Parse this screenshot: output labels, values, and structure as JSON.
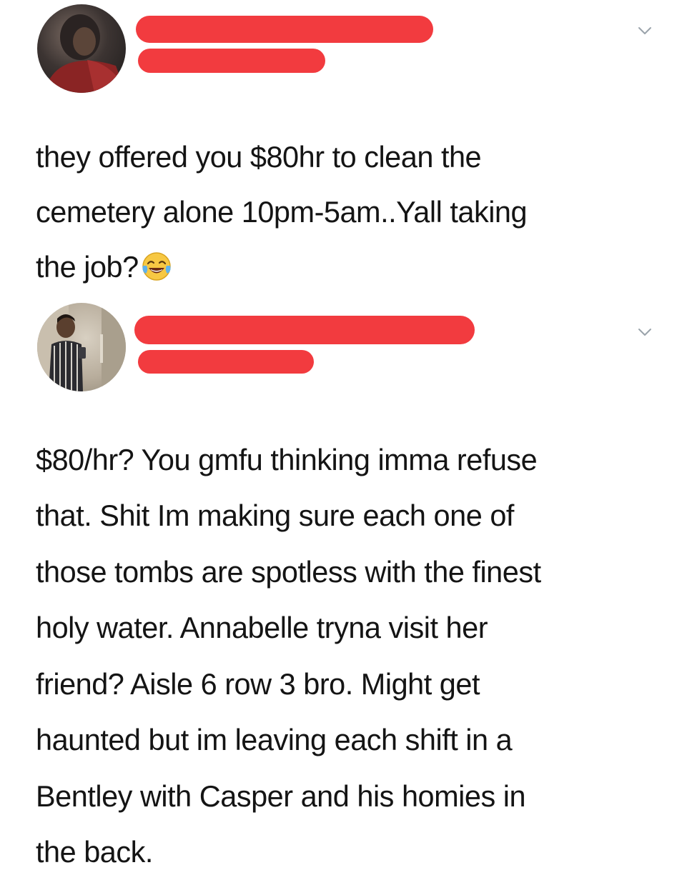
{
  "posts": [
    {
      "avatar_icon": "avatar-photo-dark",
      "name_redacted": true,
      "handle_redacted": true,
      "menu_icon": "chevron-down-icon",
      "text": "they offered you $80hr to clean the\ncemetery alone 10pm-5am..Yall taking\nthe job?",
      "emoji_icon": "face-with-tears-of-joy-emoji"
    },
    {
      "avatar_icon": "avatar-photo-mirror-selfie",
      "name_redacted": true,
      "handle_redacted": true,
      "menu_icon": "chevron-down-icon",
      "text": "$80/hr? You gmfu thinking imma refuse\nthat. Shit Im making sure each one of\nthose tombs are spotless with the finest\nholy water. Annabelle tryna visit her\nfriend? Aisle 6 row 3 bro. Might get\nhaunted but im leaving each shift in a\nBentley with Casper and his homies in\nthe back."
    }
  ],
  "colors": {
    "redaction": "#f23b3f",
    "text": "#141414",
    "chevron": "#9aa3ab",
    "background": "#ffffff"
  }
}
